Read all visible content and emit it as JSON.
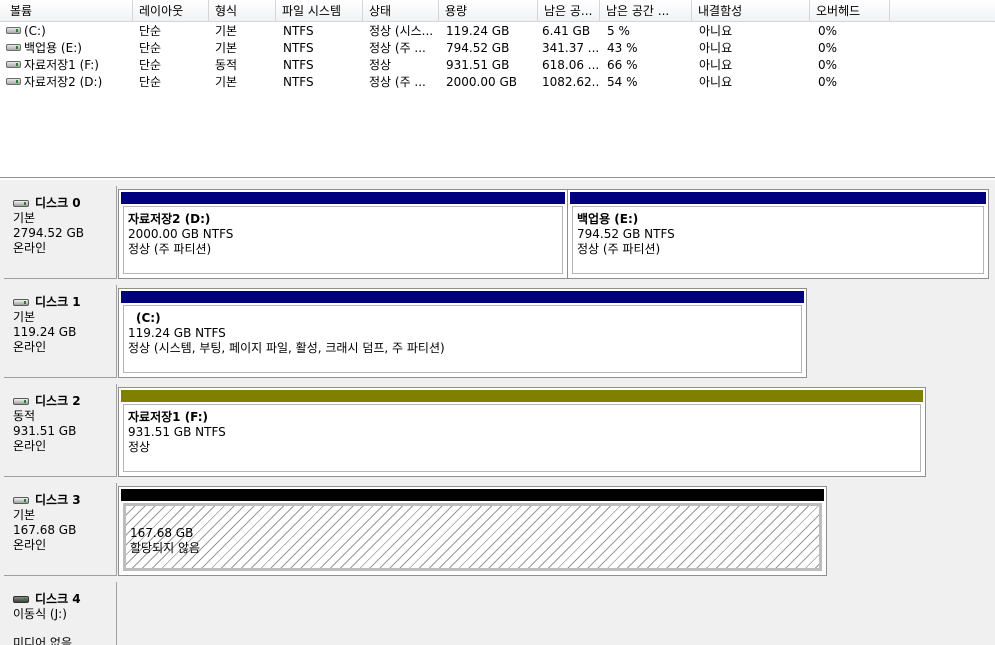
{
  "columns": [
    "볼륨",
    "레이아웃",
    "형식",
    "파일 시스템",
    "상태",
    "용량",
    "남은 공...",
    "남은 공간 ...",
    "내결함성",
    "오버헤드"
  ],
  "volumes": [
    {
      "name": "(C:)",
      "layout": "단순",
      "type": "기본",
      "fs": "NTFS",
      "status": "정상 (시스...",
      "capacity": "119.24 GB",
      "free": "6.41 GB",
      "free_pct": "5 %",
      "fault_tolerance": "아니요",
      "overhead": "0%"
    },
    {
      "name": "백업용 (E:)",
      "layout": "단순",
      "type": "기본",
      "fs": "NTFS",
      "status": "정상 (주 ...",
      "capacity": "794.52 GB",
      "free": "341.37 ...",
      "free_pct": "43 %",
      "fault_tolerance": "아니요",
      "overhead": "0%"
    },
    {
      "name": "자료저장1 (F:)",
      "layout": "단순",
      "type": "동적",
      "fs": "NTFS",
      "status": "정상",
      "capacity": "931.51 GB",
      "free": "618.06 ...",
      "free_pct": "66 %",
      "fault_tolerance": "아니요",
      "overhead": "0%"
    },
    {
      "name": "자료저장2 (D:)",
      "layout": "단순",
      "type": "기본",
      "fs": "NTFS",
      "status": "정상 (주 ...",
      "capacity": "2000.00 GB",
      "free": "1082.62...",
      "free_pct": "54 %",
      "fault_tolerance": "아니요",
      "overhead": "0%"
    }
  ],
  "disks": [
    {
      "name": "디스크 0",
      "type": "기본",
      "size": "2794.52 GB",
      "status": "온라인",
      "icon": "hard-disk-icon",
      "partitions": [
        {
          "title": "자료저장2  (D:)",
          "size": "2000.00 GB NTFS",
          "status": "정상 (주 파티션)",
          "color": "#00007f"
        },
        {
          "title": "백업용  (E:)",
          "size": "794.52 GB NTFS",
          "status": "정상 (주 파티션)",
          "color": "#00007f"
        }
      ]
    },
    {
      "name": "디스크 1",
      "type": "기본",
      "size": "119.24 GB",
      "status": "온라인",
      "icon": "hard-disk-icon",
      "partitions": [
        {
          "title": "(C:)",
          "size": "119.24 GB NTFS",
          "status": "정상 (시스템, 부팅, 페이지 파일, 활성, 크래시 덤프, 주 파티션)",
          "color": "#00007f"
        }
      ]
    },
    {
      "name": "디스크 2",
      "type": "동적",
      "size": "931.51 GB",
      "status": "온라인",
      "icon": "hard-disk-icon",
      "partitions": [
        {
          "title": "자료저장1  (F:)",
          "size": "931.51 GB NTFS",
          "status": "정상",
          "color": "#808000"
        }
      ]
    },
    {
      "name": "디스크 3",
      "type": "기본",
      "size": "167.68 GB",
      "status": "온라인",
      "icon": "hard-disk-icon",
      "partitions": [
        {
          "size": "167.68 GB",
          "status": "할당되지 않음",
          "color": "#000000"
        }
      ]
    },
    {
      "name": "디스크 4",
      "type": "이동식 (J:)",
      "status": "미디어 없음",
      "icon": "removable-disk-icon"
    }
  ]
}
